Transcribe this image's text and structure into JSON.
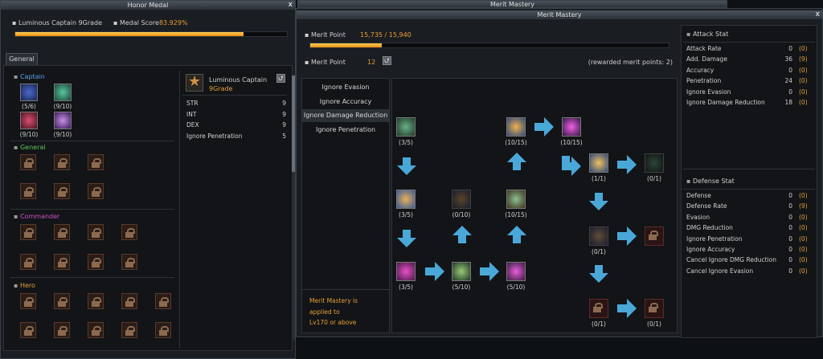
{
  "honor": {
    "title": "Honor Medal",
    "close": "x",
    "medal_name": "Luminous Captain 9Grade",
    "score_label": "Medal Score",
    "score_value": "83.929%",
    "score_progress": 0.839,
    "tab": "General",
    "captain_label": "Captain",
    "captain_counts": [
      "(5/6)",
      "(9/10)",
      "(9/10)",
      "(9/10)"
    ],
    "general_label": "General",
    "commander_label": "Commander",
    "hero_label": "Hero",
    "detail_name": "Luminous Captain",
    "detail_grade": "9Grade",
    "stats": [
      {
        "label": "STR",
        "value": "9"
      },
      {
        "label": "INT",
        "value": "9"
      },
      {
        "label": "DEX",
        "value": "9"
      },
      {
        "label": "Ignore Penetration",
        "value": "5"
      }
    ]
  },
  "merit_bg": {
    "title": "Merit Mastery"
  },
  "merit": {
    "title": "Merit Mastery",
    "close": "x",
    "point_label": "Merit Point",
    "point_value": "15,735 / 15,940",
    "point_progress": 0.2,
    "level_label": "Merit Point",
    "level_value": "12",
    "rewarded": "(rewarded merit points: 2)",
    "menu": [
      "Ignore Evasion",
      "Ignore Accuracy",
      "Ignore Damage Reduction",
      "Ignore Penetration"
    ],
    "menu_selected": 2,
    "note_lines": [
      "Merit Mastery is",
      "applied to",
      "Lv170 or above"
    ],
    "nodes": [
      "(3/5)",
      "(3/5)",
      "(3/5)",
      "(0/10)",
      "(5/10)",
      "(10/15)",
      "(10/15)",
      "(5/10)",
      "(10/15)",
      "(1/1)",
      "(0/1)",
      "(0/1)",
      "(0/1)",
      "(0/1)"
    ]
  },
  "attack": {
    "title": "Attack Stat",
    "rows": [
      {
        "label": "Attack Rate",
        "value": "0",
        "bonus": "(0)"
      },
      {
        "label": "Add. Damage",
        "value": "36",
        "bonus": "(9)"
      },
      {
        "label": "Accuracy",
        "value": "0",
        "bonus": "(0)"
      },
      {
        "label": "Penetration",
        "value": "24",
        "bonus": "(0)"
      },
      {
        "label": "Ignore Evasion",
        "value": "0",
        "bonus": "(0)"
      },
      {
        "label": "Ignore Damage Reduction",
        "value": "18",
        "bonus": "(0)"
      }
    ]
  },
  "defense": {
    "title": "Defense Stat",
    "rows": [
      {
        "label": "Defense",
        "value": "0",
        "bonus": "(0)"
      },
      {
        "label": "Defense Rate",
        "value": "0",
        "bonus": "(9)"
      },
      {
        "label": "Evasion",
        "value": "0",
        "bonus": "(0)"
      },
      {
        "label": "DMG Reduction",
        "value": "0",
        "bonus": "(0)"
      },
      {
        "label": "Ignore Penetration",
        "value": "0",
        "bonus": "(0)"
      },
      {
        "label": "Ignore Accuracy",
        "value": "0",
        "bonus": "(0)"
      },
      {
        "label": "Cancel Ignore DMG Reduction",
        "value": "0",
        "bonus": "(0)"
      },
      {
        "label": "Cancel Ignore Evasion",
        "value": "0",
        "bonus": "(0)"
      }
    ]
  },
  "colors": {
    "accent": "#e8a035",
    "arrow": "#4aa8d8",
    "captain": "#5aa0e8",
    "general": "#58c858",
    "commander": "#d050c8",
    "hero": "#e8a035"
  }
}
